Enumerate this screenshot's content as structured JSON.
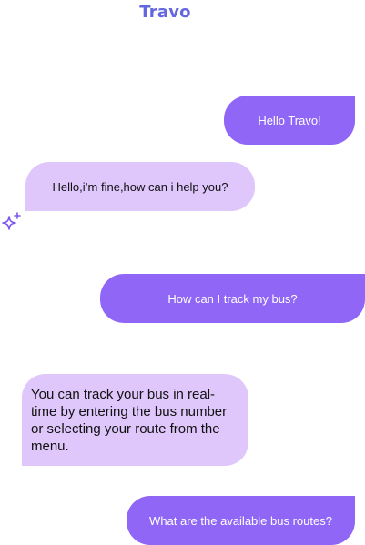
{
  "header": {
    "title": "Travo"
  },
  "messages": [
    {
      "sender": "user",
      "text": "Hello Travo!"
    },
    {
      "sender": "bot",
      "text": "Hello,i’m fine,how can i help you?"
    },
    {
      "sender": "user",
      "text": "How can I track my bus?"
    },
    {
      "sender": "bot",
      "text": "You can track your bus in real-time by entering the bus number or selecting your route from the menu."
    },
    {
      "sender": "user",
      "text": "What are the available bus routes?"
    }
  ],
  "icons": {
    "bot_avatar": "sparkle-icon"
  },
  "colors": {
    "title": "#6466e0",
    "user_bubble": "#8f66f6",
    "bot_bubble": "#dfc6fb",
    "sparkle": "#7b55f0"
  }
}
